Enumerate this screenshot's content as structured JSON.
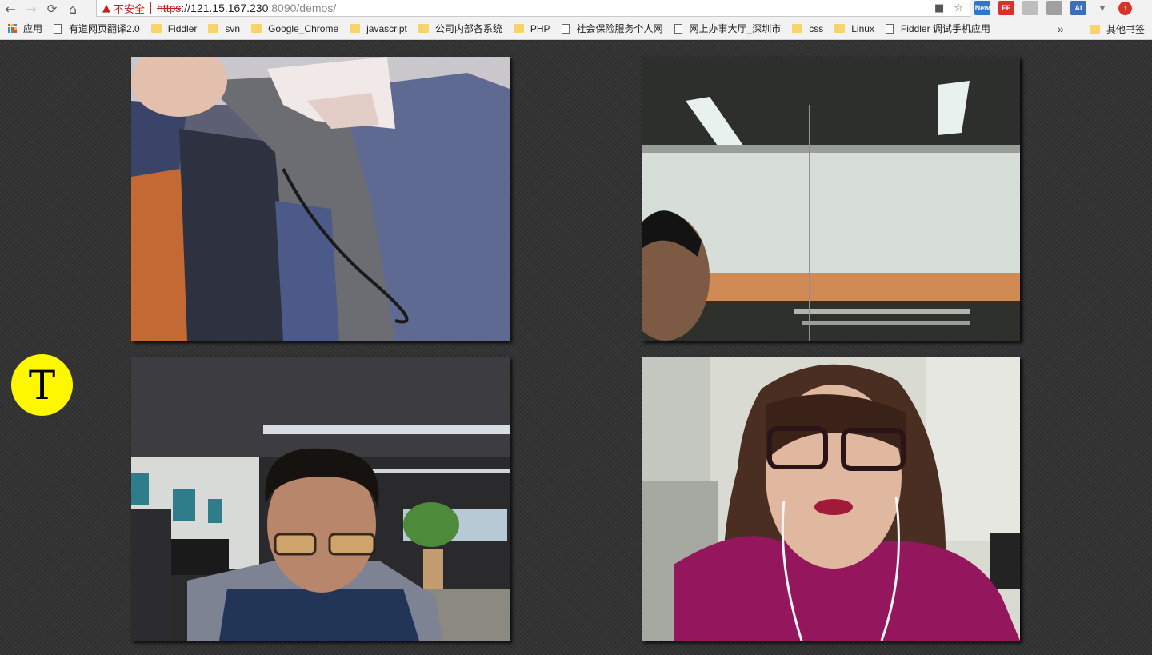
{
  "browser": {
    "nav": {
      "back": "←",
      "forward": "→",
      "reload": "C",
      "home": "⌂"
    },
    "security_warning": "不安全",
    "url": {
      "scheme": "https",
      "host": "://121.15.167.230",
      "path": ":8090/demos/"
    },
    "extensions": [
      "New",
      "FE",
      "Ai"
    ],
    "bookmarks": [
      {
        "label": "应用",
        "icon": "apps-icon"
      },
      {
        "label": "有道网页翻译2.0",
        "icon": "page-icon"
      },
      {
        "label": "Fiddler",
        "icon": "folder-icon"
      },
      {
        "label": "svn",
        "icon": "folder-icon"
      },
      {
        "label": "Google_Chrome",
        "icon": "folder-icon"
      },
      {
        "label": "javascript",
        "icon": "folder-icon"
      },
      {
        "label": "公司内部各系统",
        "icon": "folder-icon"
      },
      {
        "label": "PHP",
        "icon": "folder-icon"
      },
      {
        "label": "社会保险服务个人网",
        "icon": "page-icon"
      },
      {
        "label": "网上办事大厅_深圳市",
        "icon": "page-icon"
      },
      {
        "label": "css",
        "icon": "folder-icon"
      },
      {
        "label": "Linux",
        "icon": "folder-icon"
      },
      {
        "label": "Fiddler 调试手机应用",
        "icon": "page-icon"
      }
    ],
    "bookmarks_overflow": "»",
    "other_bookmarks": "其他书签"
  },
  "participant_avatar": {
    "initial": "T",
    "color": "#fff700"
  },
  "video_tiles": [
    {
      "name": "video-tile-1"
    },
    {
      "name": "video-tile-2"
    },
    {
      "name": "video-tile-3"
    },
    {
      "name": "video-tile-4"
    }
  ]
}
